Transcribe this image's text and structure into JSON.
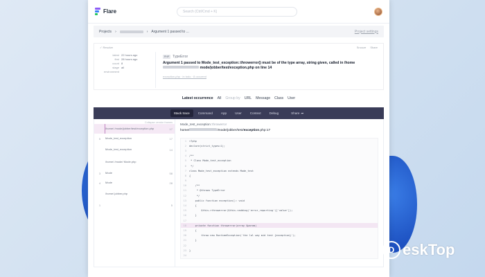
{
  "app": {
    "name": "Flare"
  },
  "search": {
    "placeholder": "Search (Ctrl/Cmd + K)"
  },
  "breadcrumb": {
    "projects": "Projects",
    "current": "Argument 1 passed to ...",
    "settings": "Project settings"
  },
  "card": {
    "toolbar_left": "Resolve",
    "toolbar_right": [
      "Snooze",
      "Share"
    ],
    "meta": [
      {
        "key": "latest",
        "value": "22 hours ago"
      },
      {
        "key": "first",
        "value": "28 hours ago"
      },
      {
        "key": "count",
        "value": "8"
      },
      {
        "key": "stage",
        "value": "all"
      },
      {
        "key": "environment",
        "value": ""
      }
    ],
    "error_type": "TypeError",
    "php_badge": "PHP",
    "message": "Argument 1 passed to Mode_test_exception::throwerror() must be of the type array, string given, called in /home",
    "message_tail": "mode/jobber/test/exception.php on line 14",
    "links": "exception.php · in todo · 8 occurred"
  },
  "occurrence": {
    "latest": "Latest occurrence",
    "all": "All",
    "group_by": "Group by",
    "options": [
      "URL",
      "Message",
      "Class",
      "User"
    ]
  },
  "tabs": [
    "Stack trace",
    "Command",
    "App",
    "User",
    "Context",
    "Debug"
  ],
  "share_label": "Share",
  "frames": {
    "collapse": "Collapse vendor frames",
    "items": [
      {
        "num": "",
        "text": "/home/ /mode/jobber/test/exception.php",
        "line": "17",
        "selected": true
      },
      {
        "num": "5",
        "text": "Mode_test_exception",
        "line": "17",
        "selected": false
      },
      {
        "num": "",
        "text": "Mode_test_exception",
        "line": "14",
        "selected": false
      },
      {
        "num": "",
        "text": "/home/ /mode/ Mode.php",
        "line": "",
        "selected": false
      },
      {
        "num": "3",
        "text": "Mode",
        "line": "58",
        "selected": false
      },
      {
        "num": "4",
        "text": "Mode",
        "line": "28",
        "selected": false
      },
      {
        "num": "",
        "text": "/home/ jobber.php",
        "line": "",
        "selected": false
      },
      {
        "num": "1",
        "text": "",
        "line": "5",
        "selected": false
      }
    ]
  },
  "code": {
    "file": "Mode_test_exception",
    "file_method": "throwerror",
    "path_prefix": "home/",
    "path_mid": "/mode/jobber/test/",
    "path_file": "exception",
    "path_ext": ".php:17",
    "lines": [
      {
        "ln": "1",
        "src": "<?php",
        "hl": false
      },
      {
        "ln": "2",
        "src": "declare(strict_types=1);",
        "hl": false
      },
      {
        "ln": "3",
        "src": "",
        "hl": false
      },
      {
        "ln": "4",
        "src": "/**",
        "hl": false
      },
      {
        "ln": "5",
        "src": " * Class Mode_test_exception",
        "hl": false
      },
      {
        "ln": "6",
        "src": " */",
        "hl": false
      },
      {
        "ln": "7",
        "src": "class Mode_test_exception extends Mode_test",
        "hl": false
      },
      {
        "ln": "8",
        "src": "{",
        "hl": false
      },
      {
        "ln": "9",
        "src": "",
        "hl": false
      },
      {
        "ln": "10",
        "src": "    /**",
        "hl": false
      },
      {
        "ln": "11",
        "src": "     * @throws TypeError",
        "hl": false
      },
      {
        "ln": "12",
        "src": "     */",
        "hl": false
      },
      {
        "ln": "13",
        "src": "    public function exception(): void",
        "hl": false
      },
      {
        "ln": "14",
        "src": "    {",
        "hl": false
      },
      {
        "ln": "15",
        "src": "        $this->throwerror($this->adding('error_reporting')['value']);",
        "hl": false
      },
      {
        "ln": "16",
        "src": "    }",
        "hl": false
      },
      {
        "ln": "17",
        "src": "",
        "hl": false
      },
      {
        "ln": "18",
        "src": "    private function throwerror(array $param)",
        "hl": true
      },
      {
        "ln": "19",
        "src": "    {",
        "hl": false
      },
      {
        "ln": "20",
        "src": "        throw new RuntimeException('the lol way mid test {exception}');",
        "hl": false
      },
      {
        "ln": "21",
        "src": "    }",
        "hl": false
      },
      {
        "ln": "22",
        "src": "",
        "hl": false
      },
      {
        "ln": "23",
        "src": "}",
        "hl": false
      },
      {
        "ln": "24",
        "src": "",
        "hl": false
      }
    ]
  },
  "watermark": {
    "text": "eskTop"
  },
  "colors": {
    "tab_bar": "#3a3c58",
    "accent": "#8b5cf6",
    "highlight": "#f3e6f3"
  }
}
